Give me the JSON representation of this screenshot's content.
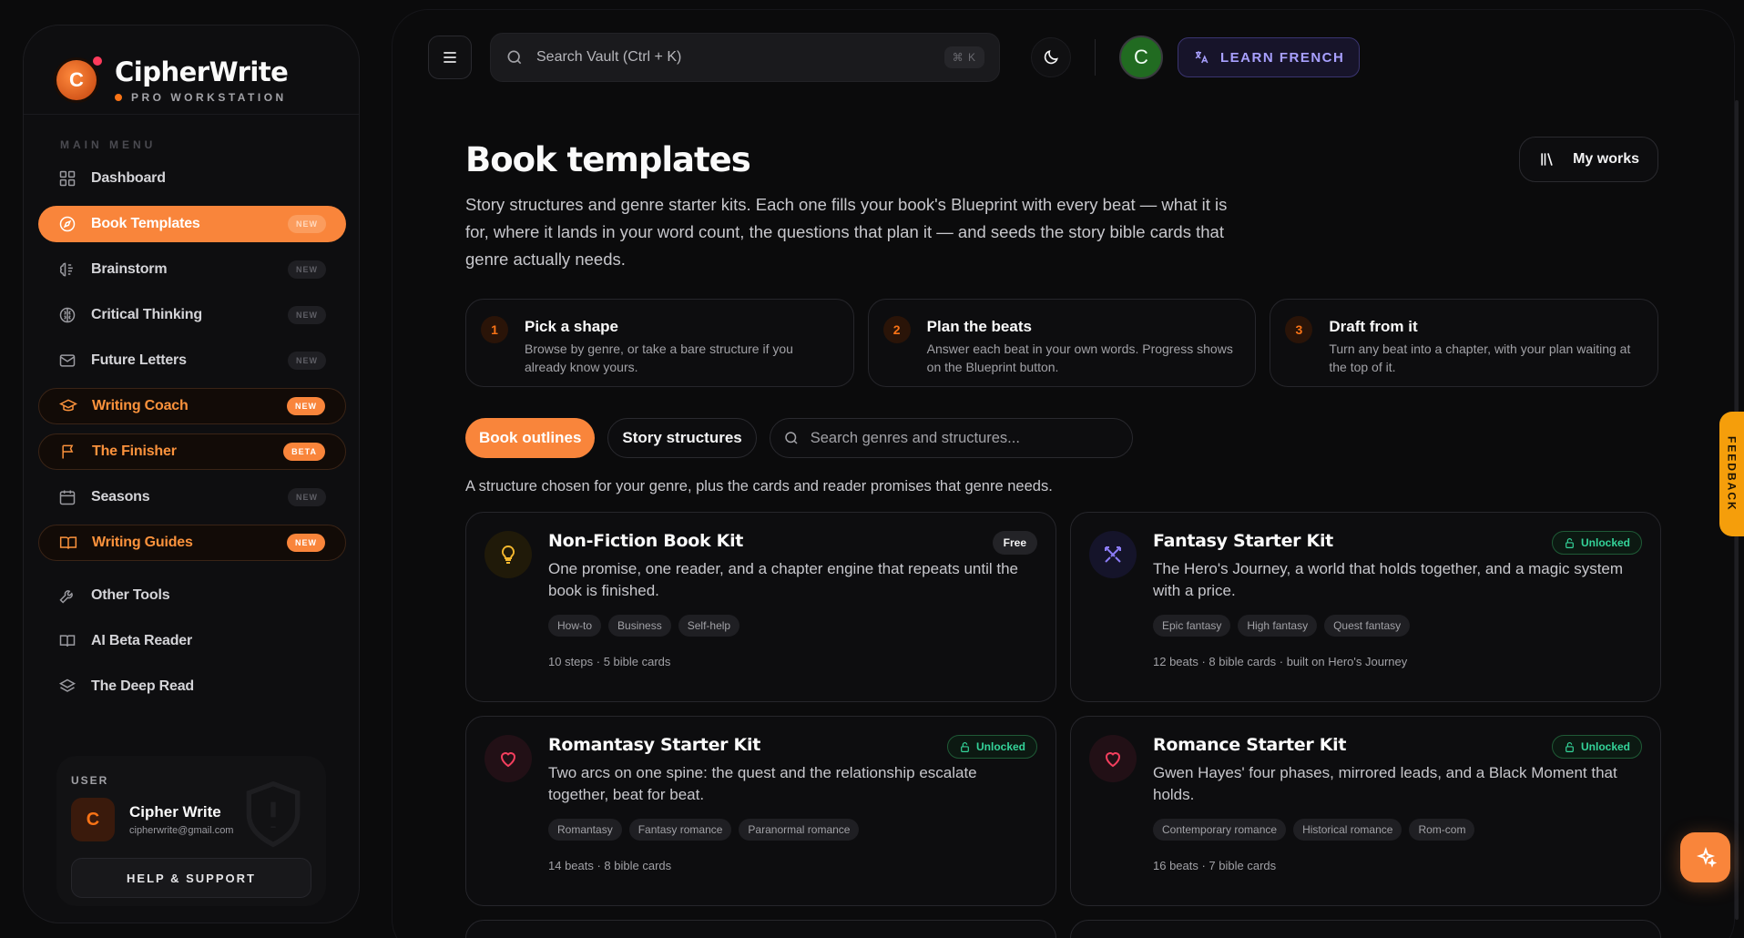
{
  "brand": {
    "name": "CipherWrite",
    "subtitle": "PRO WORKSTATION",
    "logo_letter": "C"
  },
  "sidebar": {
    "menu_label": "MAIN MENU",
    "items": [
      {
        "label": "Dashboard",
        "icon": "grid-icon",
        "tag": ""
      },
      {
        "label": "Book Templates",
        "icon": "compass-icon",
        "tag": "NEW",
        "state": "active"
      },
      {
        "label": "Brainstorm",
        "icon": "brain-icon",
        "tag": "NEW"
      },
      {
        "label": "Critical Thinking",
        "icon": "brain-circle-icon",
        "tag": "NEW"
      },
      {
        "label": "Future Letters",
        "icon": "mail-icon",
        "tag": "NEW"
      },
      {
        "label": "Writing Coach",
        "icon": "graduation-cap-icon",
        "tag": "NEW",
        "state": "highlight"
      },
      {
        "label": "The Finisher",
        "icon": "flag-icon",
        "tag": "BETA",
        "state": "highlight"
      },
      {
        "label": "Seasons",
        "icon": "calendar-icon",
        "tag": "NEW"
      },
      {
        "label": "Writing Guides",
        "icon": "book-open-icon",
        "tag": "NEW",
        "state": "highlight"
      },
      {
        "label": "Other Tools",
        "icon": "wrench-icon",
        "tag": ""
      },
      {
        "label": "AI Beta Reader",
        "icon": "book-reader-icon",
        "tag": ""
      },
      {
        "label": "The Deep Read",
        "icon": "layers-icon",
        "tag": ""
      }
    ],
    "user": {
      "label": "USER",
      "avatar_letter": "C",
      "name": "Cipher Write",
      "email": "cipherwrite@gmail.com",
      "help_label": "HELP & SUPPORT"
    }
  },
  "topbar": {
    "search_placeholder": "Search Vault (Ctrl + K)",
    "search_shortcut": "⌘ K",
    "avatar_letter": "C",
    "learn_label": "LEARN FRENCH"
  },
  "page": {
    "title": "Book templates",
    "my_works_label": "My works",
    "subtitle": "Story structures and genre starter kits. Each one fills your book's Blueprint with every beat — what it is for, where it lands in your word count, the questions that plan it — and seeds the story bible cards that genre actually needs.",
    "steps": [
      {
        "num": "1",
        "title": "Pick a shape",
        "desc": "Browse by genre, or take a bare structure if you already know yours."
      },
      {
        "num": "2",
        "title": "Plan the beats",
        "desc": "Answer each beat in your own words. Progress shows on the Blueprint button."
      },
      {
        "num": "3",
        "title": "Draft from it",
        "desc": "Turn any beat into a chapter, with your plan waiting at the top of it."
      }
    ],
    "tabs": {
      "outlines": "Book outlines",
      "structures": "Story structures"
    },
    "filter_placeholder": "Search genres and structures...",
    "filter_note": "A structure chosen for your genre, plus the cards and reader promises that genre needs.",
    "cards": [
      {
        "title": "Non-Fiction Book Kit",
        "badge": "Free",
        "desc": "One promise, one reader, and a chapter engine that repeats until the book is finished.",
        "tags": [
          "How-to",
          "Business",
          "Self-help"
        ],
        "meta": "10 steps · 5 bible cards",
        "icon": "lightbulb-icon"
      },
      {
        "title": "Fantasy Starter Kit",
        "badge": "Unlocked",
        "desc": "The Hero's Journey, a world that holds together, and a magic system with a price.",
        "tags": [
          "Epic fantasy",
          "High fantasy",
          "Quest fantasy"
        ],
        "meta": "12 beats · 8 bible cards · built on Hero's Journey",
        "icon": "swords-icon"
      },
      {
        "title": "Romantasy Starter Kit",
        "badge": "Unlocked",
        "desc": "Two arcs on one spine: the quest and the relationship escalate together, beat for beat.",
        "tags": [
          "Romantasy",
          "Fantasy romance",
          "Paranormal romance"
        ],
        "meta": "14 beats · 8 bible cards",
        "icon": "heart-icon"
      },
      {
        "title": "Romance Starter Kit",
        "badge": "Unlocked",
        "desc": "Gwen Hayes' four phases, mirrored leads, and a Black Moment that holds.",
        "tags": [
          "Contemporary romance",
          "Historical romance",
          "Rom-com"
        ],
        "meta": "16 beats · 7 bible cards",
        "icon": "heart-icon"
      }
    ],
    "feedback_label": "FEEDBACK"
  },
  "colors": {
    "accent": "#f9853b",
    "success": "#34d399",
    "learn": "#a8a0ff"
  }
}
